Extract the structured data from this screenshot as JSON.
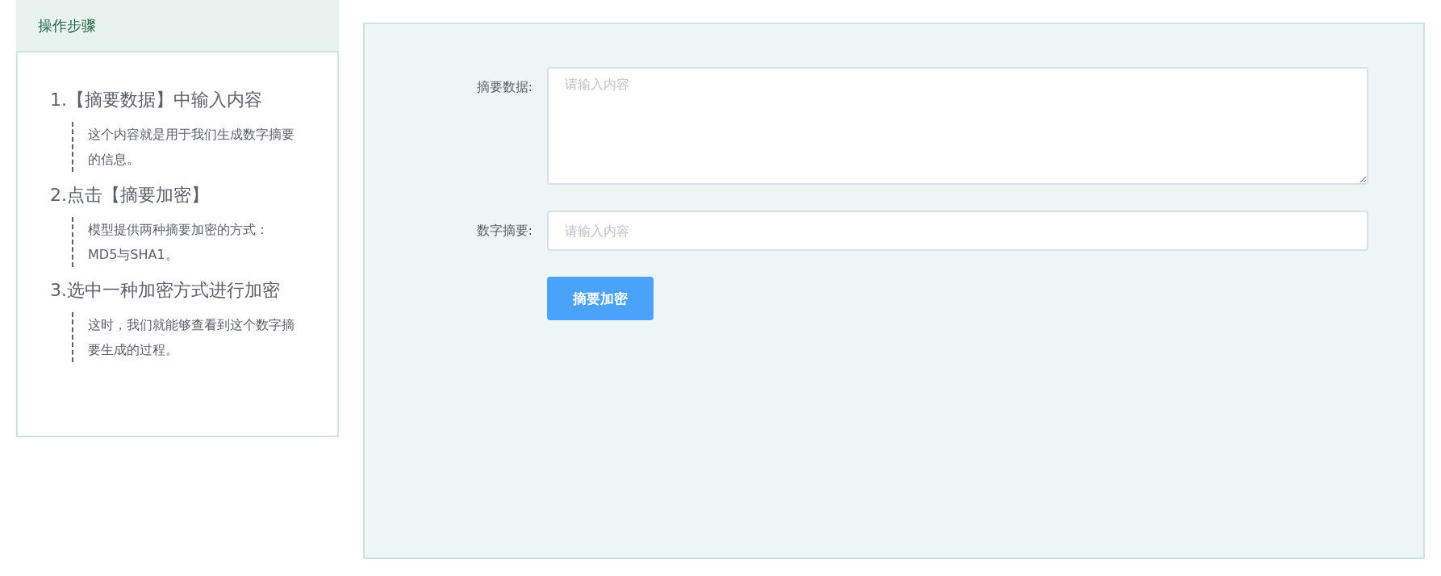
{
  "steps_panel": {
    "title": "操作步骤",
    "steps": [
      {
        "title": "1.【摘要数据】中输入内容",
        "description": "这个内容就是用于我们生成数字摘要的信息。"
      },
      {
        "title": "2.点击【摘要加密】",
        "description": "模型提供两种摘要加密的方式：MD5与SHA1。"
      },
      {
        "title": "3.选中一种加密方式进行加密",
        "description": "这时，我们就能够查看到这个数字摘要生成的过程。"
      }
    ]
  },
  "form": {
    "fields": [
      {
        "kind": "textarea",
        "label": "摘要数据:",
        "placeholder": "请输入内容"
      },
      {
        "kind": "input",
        "label": "数字摘要:",
        "placeholder": "请输入内容"
      }
    ],
    "button": "摘要加密"
  }
}
